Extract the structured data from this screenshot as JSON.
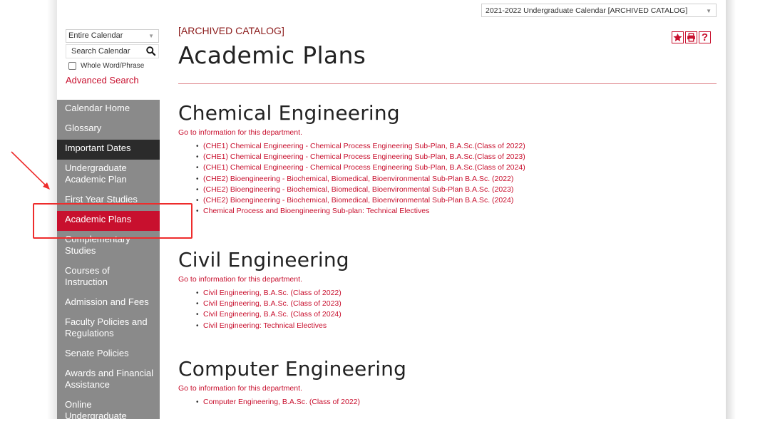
{
  "catalog_selector": {
    "value": "2021-2022 Undergraduate Calendar [ARCHIVED CATALOG]"
  },
  "toolbar": {
    "icons": [
      "star-icon",
      "print-icon",
      "help-icon"
    ],
    "help_glyph": "?"
  },
  "search": {
    "scope_value": "Entire Calendar",
    "placeholder": "Search Calendar",
    "whole_word_label": "Whole Word/Phrase",
    "advanced_label": "Advanced Search"
  },
  "sidebar": {
    "items": [
      {
        "label": "Calendar Home",
        "state": "normal"
      },
      {
        "label": "Glossary",
        "state": "normal"
      },
      {
        "label": "Important Dates",
        "state": "dark"
      },
      {
        "label": "Undergraduate Academic Plan",
        "state": "normal"
      },
      {
        "label": "First Year Studies",
        "state": "normal"
      },
      {
        "label": "Academic Plans",
        "state": "active"
      },
      {
        "label": "Complementary Studies",
        "state": "normal"
      },
      {
        "label": "Courses of Instruction",
        "state": "normal"
      },
      {
        "label": "Admission and Fees",
        "state": "normal"
      },
      {
        "label": "Faculty Policies and Regulations",
        "state": "normal"
      },
      {
        "label": "Senate Policies",
        "state": "normal"
      },
      {
        "label": "Awards and Financial Assistance",
        "state": "normal"
      },
      {
        "label": "Online Undergraduate",
        "state": "normal"
      }
    ]
  },
  "main": {
    "archived_label": "[ARCHIVED CATALOG]",
    "title": "Academic Plans",
    "departments": [
      {
        "name": "Chemical Engineering",
        "goto": "Go to information for this department.",
        "links": [
          "(CHE1) Chemical Engineering - Chemical Process Engineering Sub-Plan, B.A.Sc.(Class of 2022)",
          "(CHE1) Chemical Engineering - Chemical Process Engineering Sub-Plan, B.A.Sc.(Class of 2023)",
          "(CHE1) Chemical Engineering - Chemical Process Engineering Sub-Plan, B.A.Sc.(Class of 2024)",
          "(CHE2) Bioengineering - Biochemical, Biomedical, Bioenvironmental Sub-Plan B.A.Sc. (2022)",
          "(CHE2) Bioengineering - Biochemical, Biomedical, Bioenvironmental Sub-Plan B.A.Sc. (2023)",
          "(CHE2) Bioengineering - Biochemical, Biomedical, Bioenvironmental Sub-Plan B.A.Sc. (2024)",
          "Chemical Process and Bioengineering Sub-plan: Technical Electives"
        ]
      },
      {
        "name": "Civil Engineering",
        "goto": "Go to information for this department.",
        "links": [
          "Civil Engineering, B.A.Sc. (Class of 2022)",
          "Civil Engineering, B.A.Sc. (Class of 2023)",
          "Civil Engineering, B.A.Sc. (Class of 2024)",
          "Civil Engineering: Technical Electives"
        ]
      },
      {
        "name": "Computer Engineering",
        "goto": "Go to information for this department.",
        "links": [
          "Computer Engineering, B.A.Sc. (Class of 2022)"
        ]
      }
    ]
  },
  "colors": {
    "accent": "#c8102e",
    "nav_bg": "#8a8a8a",
    "nav_dark": "#2b2b2b",
    "annotation": "#ee2c2c"
  }
}
